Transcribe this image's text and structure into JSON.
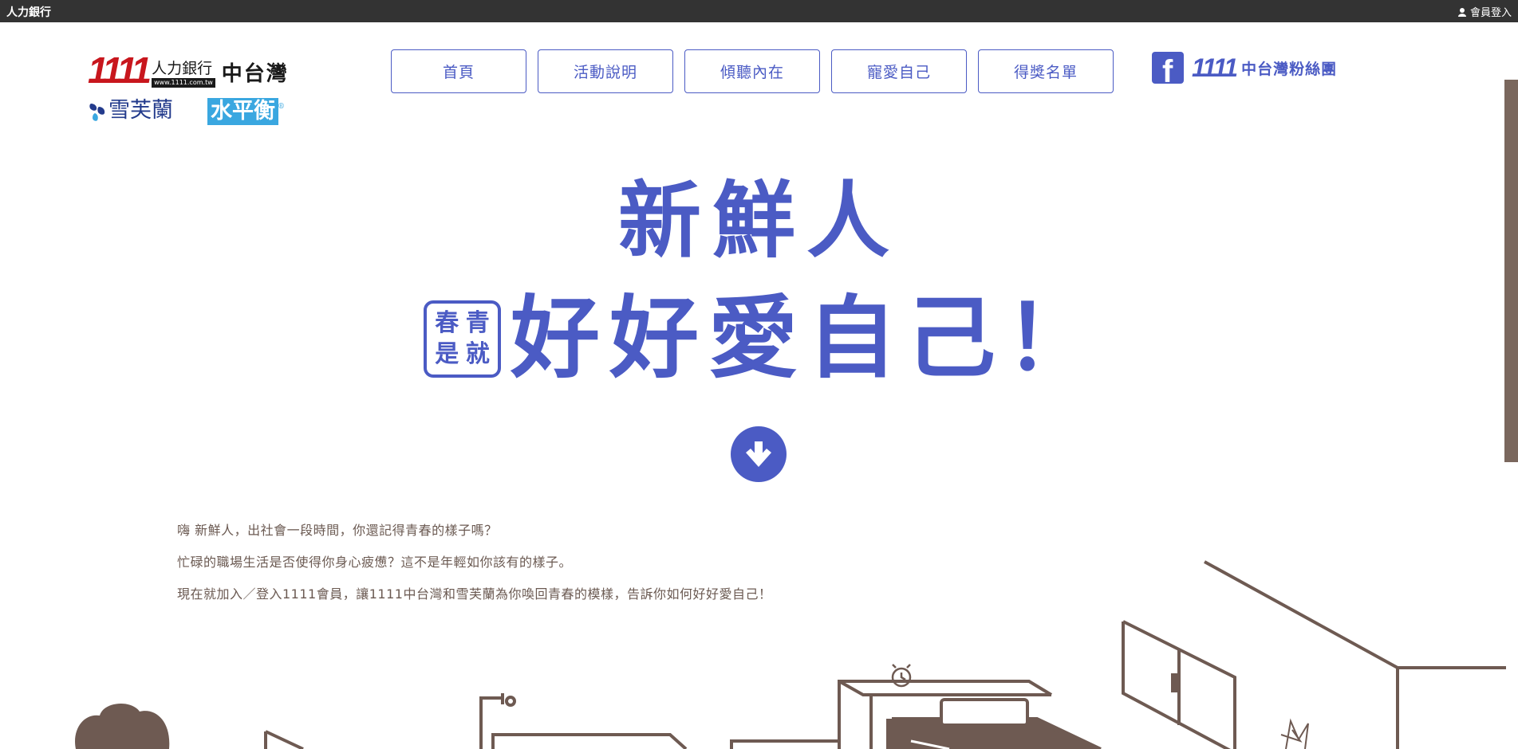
{
  "topbar": {
    "site_name": "人力銀行",
    "member_login": "會員登入"
  },
  "logos": {
    "bank_digits": "1111",
    "bank_name": "人力銀行",
    "bank_url": "www.1111.com.tw",
    "region": "中台灣",
    "partner1": "雪芙蘭",
    "partner2": "水平衡",
    "partner2_mark": "®"
  },
  "nav": {
    "items": [
      {
        "label": "首頁"
      },
      {
        "label": "活動說明"
      },
      {
        "label": "傾聽內在"
      },
      {
        "label": "寵愛自己"
      },
      {
        "label": "得獎名單"
      }
    ]
  },
  "fan_page": {
    "icon": "facebook-icon",
    "fb_letter": "f",
    "number": "1111",
    "label": "中台灣粉絲團"
  },
  "hero": {
    "line1": "新鮮人",
    "stamp_chars": [
      "青",
      "春",
      "就",
      "是"
    ],
    "line2": "好好愛自己！",
    "down_icon": "arrow-down-circle-icon"
  },
  "intro": {
    "paragraphs": [
      "嗨 新鮮人，出社會一段時間，你還記得青春的樣子嗎？",
      "忙碌的職場生活是否使得你身心疲憊？這不是年輕如你該有的樣子。",
      "現在就加入／登入1111會員，讓1111中台灣和雪芙蘭為你喚回青春的模樣，告訴你如何好好愛自己！"
    ]
  },
  "colors": {
    "brand_blue": "#4b5bc4",
    "text_brown": "#6b5a52",
    "topbar_bg": "#333333",
    "illustration_brown": "#6e5a52"
  }
}
